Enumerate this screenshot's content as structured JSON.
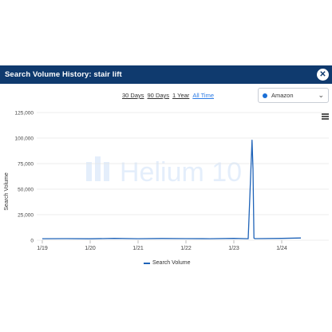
{
  "modal": {
    "title": "Search Volume History: stair lift",
    "close_icon": "close-icon"
  },
  "controls": {
    "ranges": [
      "30 Days",
      "90 Days",
      "1 Year",
      "All Time"
    ],
    "active_range": "All Time",
    "marketplace": "Amazon",
    "menu_icon": "hamburger-menu-icon"
  },
  "watermark": "Helium 10",
  "chart_data": {
    "type": "line",
    "ylabel": "Search Volume",
    "ylim": [
      0,
      125000
    ],
    "yticks": [
      "0",
      "25,000",
      "50,000",
      "75,000",
      "100,000",
      "125,000"
    ],
    "xticks": [
      "1/19",
      "1/20",
      "1/21",
      "1/22",
      "1/23",
      "1/24"
    ],
    "series": [
      {
        "name": "Search Volume",
        "color": "#1f63b8",
        "x": [
          0,
          0.5,
          1,
          1.5,
          2,
          2.5,
          3,
          3.5,
          4,
          4.3,
          4.38,
          4.4,
          4.42,
          4.44,
          4.5,
          5,
          5.4
        ],
        "values": [
          1500,
          1600,
          1400,
          1800,
          1500,
          1700,
          1600,
          1500,
          1800,
          1500,
          98000,
          70000,
          2000,
          1600,
          1600,
          1800,
          2200
        ]
      }
    ]
  }
}
